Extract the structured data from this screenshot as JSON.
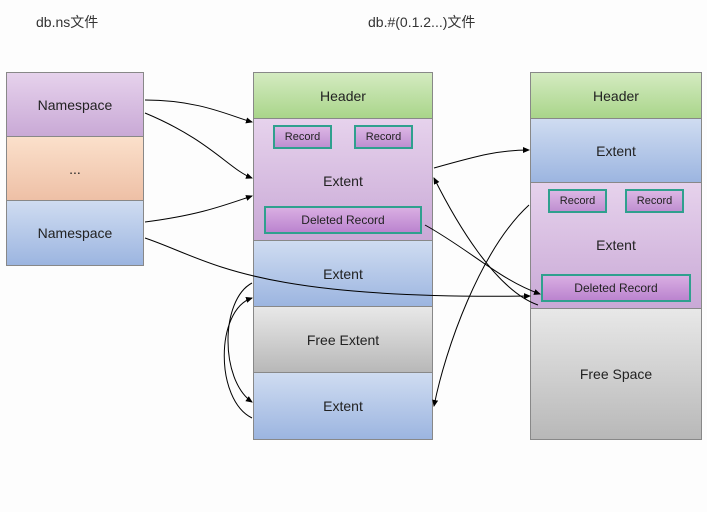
{
  "titles": {
    "left": "db.ns文件",
    "right": "db.#(0.1.2...)文件"
  },
  "ns_column": {
    "top": "Namespace",
    "mid": "...",
    "bot": "Namespace"
  },
  "mid_column": {
    "header": "Header",
    "extent1": {
      "label": "Extent",
      "rec1": "Record",
      "rec2": "Record",
      "deleted": "Deleted Record"
    },
    "extent2": "Extent",
    "free_extent": "Free Extent",
    "extent3": "Extent"
  },
  "right_column": {
    "header": "Header",
    "extent_top": "Extent",
    "extent_mid": {
      "label": "Extent",
      "rec1": "Record",
      "rec2": "Record",
      "deleted": "Deleted Record"
    },
    "free_space": "Free Space"
  }
}
